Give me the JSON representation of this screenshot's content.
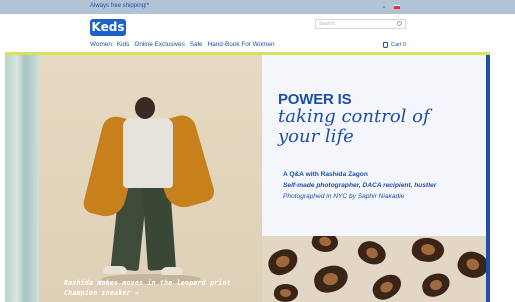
{
  "promo": {
    "text": "Always free shipping!*"
  },
  "brand": {
    "logo": "Keds",
    "accent": "#1e4fa8",
    "promo_bg": "#b3c3d6",
    "line": "#d8e35a"
  },
  "search": {
    "placeholder": "Search"
  },
  "nav": {
    "items": [
      "Women",
      "Kids",
      "Online Exclusives",
      "Sale",
      "Hand-Book For Women"
    ],
    "cart_label": "Cart 0"
  },
  "hero": {
    "headline_top": "POWER IS",
    "headline_bottom": "taking control of your life",
    "qa_title": "A Q&A with Rashida Zagon",
    "qa_subtitle": "Self-made photographer, DACA recipient, hustler",
    "qa_credit": "Photographed in NYC by Saphir Niakadie",
    "caption": "Rashida makes moves in the leopard print Champion sneaker →"
  },
  "icons": [
    "flag-icon",
    "search-icon",
    "cart-icon"
  ]
}
